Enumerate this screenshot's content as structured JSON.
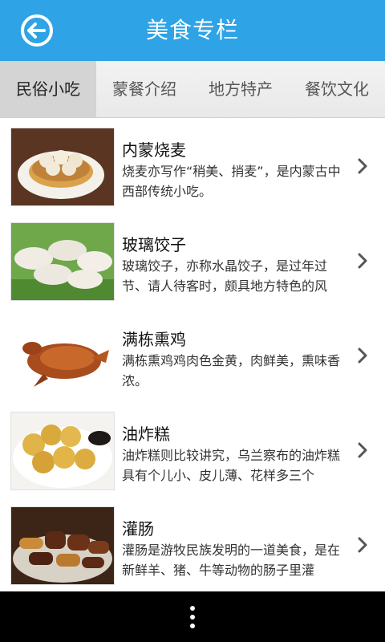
{
  "header": {
    "title": "美食专栏"
  },
  "tabs": [
    {
      "label": "民俗小吃",
      "active": true
    },
    {
      "label": "蒙餐介绍",
      "active": false
    },
    {
      "label": "地方特产",
      "active": false
    },
    {
      "label": "餐饮文化",
      "active": false
    }
  ],
  "items": [
    {
      "title": "内蒙烧麦",
      "desc": "烧麦亦写作“稍美、捎麦”，是内蒙古中西部传统小吃。",
      "image": "shaomai-photo"
    },
    {
      "title": "玻璃饺子",
      "desc": "玻璃饺子，亦称水晶饺子，是过年过节、请人待客时，颇具地方特色的风",
      "image": "dumplings-photo"
    },
    {
      "title": "满栋熏鸡",
      "desc": "满栋熏鸡鸡肉色金黄，肉鲜美，熏味香浓。",
      "image": "smoked-chicken-photo"
    },
    {
      "title": "油炸糕",
      "desc": "油炸糕则比较讲究，乌兰察布的油炸糕具有个儿小、皮儿薄、花样多三个",
      "image": "fried-cake-photo"
    },
    {
      "title": "灌肠",
      "desc": "灌肠是游牧民族发明的一道美食，是在新鲜羊、猪、牛等动物的肠子里灌",
      "image": "sausage-photo"
    }
  ],
  "colors": {
    "header": "#2ea3e5",
    "active_tab": "#d4d4d4",
    "navbar": "#000000"
  },
  "icons": {
    "back": "back-arrow-icon",
    "chevron": "chevron-right-icon",
    "menu": "overflow-menu-icon"
  }
}
